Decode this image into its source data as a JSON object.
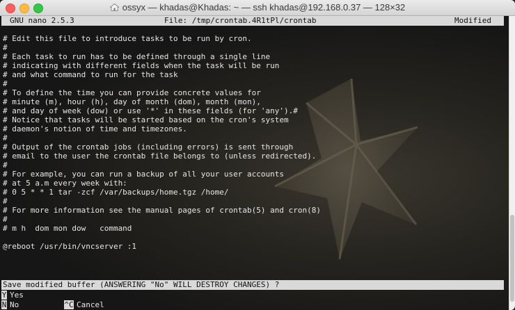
{
  "window": {
    "title": "ossyx — khadas@Khadas: ~ — ssh khadas@192.168.0.37 — 128×32"
  },
  "nano": {
    "version": "GNU nano 2.5.3",
    "file": "File: /tmp/crontab.4R1tPl/crontab",
    "status": "Modified"
  },
  "lines": [
    "# Edit this file to introduce tasks to be run by cron.",
    "#",
    "# Each task to run has to be defined through a single line",
    "# indicating with different fields when the task will be run",
    "# and what command to run for the task",
    "#",
    "# To define the time you can provide concrete values for",
    "# minute (m), hour (h), day of month (dom), month (mon),",
    "# and day of week (dow) or use '*' in these fields (for 'any').#",
    "# Notice that tasks will be started based on the cron's system",
    "# daemon's notion of time and timezones.",
    "#",
    "# Output of the crontab jobs (including errors) is sent through",
    "# email to the user the crontab file belongs to (unless redirected).",
    "#",
    "# For example, you can run a backup of all your user accounts",
    "# at 5 a.m every week with:",
    "# 0 5 * * 1 tar -zcf /var/backups/home.tgz /home/",
    "#",
    "# For more information see the manual pages of crontab(5) and cron(8)",
    "#",
    "# m h  dom mon dow   command",
    "",
    "@reboot /usr/bin/vncserver :1"
  ],
  "prompt": {
    "text": "Save modified buffer (ANSWERING \"No\" WILL DESTROY CHANGES) ?",
    "options": [
      {
        "key": "Y",
        "label": "Yes"
      },
      {
        "key": "N",
        "label": "No"
      },
      {
        "key": "^C",
        "label": "Cancel"
      }
    ]
  }
}
